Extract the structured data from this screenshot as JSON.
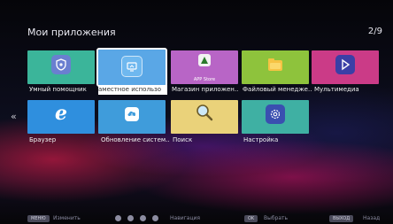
{
  "header": {
    "title": "Мои приложения",
    "page_indicator": "2/9"
  },
  "apps": [
    {
      "label": "Умный помощник",
      "icon": "shield-badge-icon",
      "color": "#3bb59a",
      "sub": ""
    },
    {
      "label": "аместное использо",
      "icon": "screen-share-icon",
      "color": "#5aa7e6",
      "sub": ""
    },
    {
      "label": "Магазин приложен..",
      "icon": "app-store-icon",
      "color": "#b865c6",
      "sub": "APP Store"
    },
    {
      "label": "Файловый менедже..",
      "icon": "folder-icon",
      "color": "#8ec33c",
      "sub": ""
    },
    {
      "label": "Мультимедиа",
      "icon": "play-media-icon",
      "color": "#cb3b87",
      "sub": ""
    },
    {
      "label": "Браузер",
      "icon": "browser-e-icon",
      "color": "#2f8fde",
      "sub": ""
    },
    {
      "label": "Обновление систем..",
      "icon": "cloud-download-icon",
      "color": "#3f9cdb",
      "sub": ""
    },
    {
      "label": "Поиск",
      "icon": "magnifier-icon",
      "color": "#ead27a",
      "sub": ""
    },
    {
      "label": "Настройка",
      "icon": "gear-icon",
      "color": "#3fb0a3",
      "sub": ""
    }
  ],
  "footer": {
    "menu_key": "МЕНЮ",
    "menu_text": "Изменить",
    "nav_text": "Навигация",
    "ok_key": "OK",
    "ok_text": "Выбрать",
    "exit_key": "ВЫХОД",
    "exit_text": "Назад"
  }
}
